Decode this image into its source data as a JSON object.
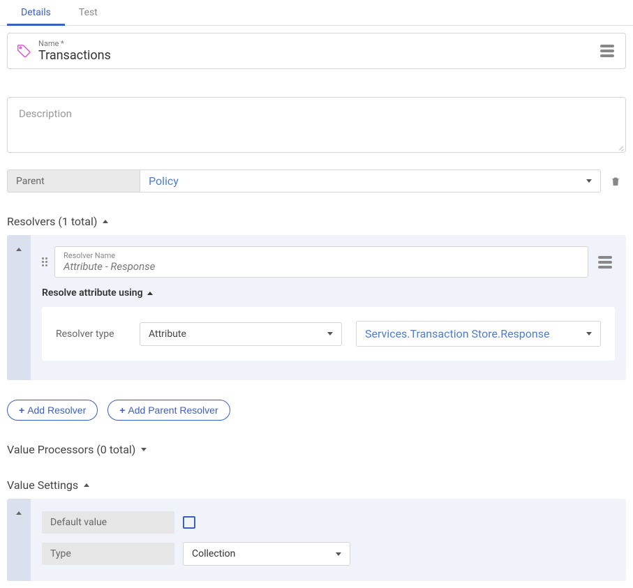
{
  "tabs": {
    "details": "Details",
    "test": "Test"
  },
  "name_field": {
    "label": "Name  *",
    "value": "Transactions"
  },
  "description": {
    "placeholder": "Description"
  },
  "parent": {
    "label": "Parent",
    "value": "Policy"
  },
  "resolvers": {
    "header": "Resolvers (1 total)",
    "item": {
      "name_label": "Resolver Name",
      "name_value": "Attribute - Response",
      "resolve_using_header": "Resolve attribute using",
      "resolver_type_label": "Resolver type",
      "resolver_type_value": "Attribute",
      "resolver_target_value": "Services.Transaction Store.Response"
    },
    "add_resolver_btn": "Add Resolver",
    "add_parent_resolver_btn": "Add Parent Resolver"
  },
  "value_processors": {
    "header": "Value Processors (0 total)"
  },
  "value_settings": {
    "header": "Value Settings",
    "default_value_label": "Default value",
    "type_label": "Type",
    "type_value": "Collection"
  }
}
